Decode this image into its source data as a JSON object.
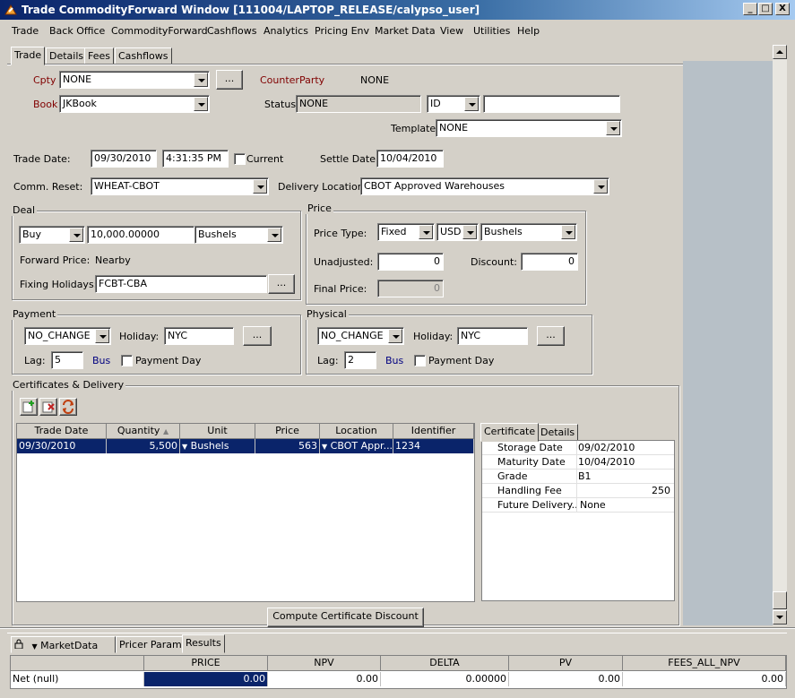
{
  "window": {
    "title": "Trade CommodityForward Window [111004/LAPTOP_RELEASE/calypso_user]",
    "min_glyph": "_",
    "max_glyph": "□",
    "close_glyph": "X"
  },
  "menu": [
    "Trade",
    "Back Office",
    "CommodityForward",
    "Cashflows",
    "Analytics",
    "Pricing Env",
    "Market Data",
    "View",
    "Utilities",
    "Help"
  ],
  "tabs": [
    "Trade",
    "Details",
    "Fees",
    "Cashflows"
  ],
  "trade": {
    "cpty_label": "Cpty",
    "cpty_value": "NONE",
    "ellipsis": "...",
    "counterparty_label": "CounterParty",
    "counterparty_value": "NONE",
    "book_label": "Book",
    "book_value": "JKBook",
    "status_label": "Status",
    "status_value": "NONE",
    "id_value": "ID",
    "id_text": "",
    "template_label": "Template",
    "template_value": "NONE",
    "trade_date_label": "Trade Date:",
    "trade_date": "09/30/2010",
    "trade_time": "4:31:35 PM",
    "current_label": "Current",
    "settle_date_label": "Settle Date:",
    "settle_date": "10/04/2010",
    "comm_reset_label": "Comm. Reset:",
    "comm_reset_value": "WHEAT-CBOT",
    "delivery_location_label": "Delivery Location:",
    "delivery_location_value": "CBOT Approved Warehouses"
  },
  "deal": {
    "title": "Deal",
    "direction": "Buy",
    "quantity": "10,000.00000",
    "unit": "Bushels",
    "forward_price_label": "Forward Price:",
    "forward_price_value": "Nearby",
    "fixing_holidays_label": "Fixing Holidays:",
    "fixing_holidays_value": "FCBT-CBA"
  },
  "price": {
    "title": "Price",
    "price_type_label": "Price Type:",
    "price_type": "Fixed",
    "currency": "USD",
    "unit": "Bushels",
    "unadjusted_label": "Unadjusted:",
    "unadjusted": "0",
    "discount_label": "Discount:",
    "discount": "0",
    "final_price_label": "Final Price:",
    "final_price": "0"
  },
  "payment": {
    "title": "Payment",
    "mode": "NO_CHANGE",
    "holiday_label": "Holiday:",
    "holiday": "NYC",
    "lag_label": "Lag:",
    "lag": "5",
    "bus_label": "Bus",
    "payment_day_label": "Payment Day"
  },
  "physical": {
    "title": "Physical",
    "mode": "NO_CHANGE",
    "holiday_label": "Holiday:",
    "holiday": "NYC",
    "lag_label": "Lag:",
    "lag": "2",
    "bus_label": "Bus",
    "payment_day_label": "Payment Day"
  },
  "certificates": {
    "title": "Certificates & Delivery",
    "columns": [
      "Trade Date",
      "Quantity",
      "Unit",
      "Price",
      "Location",
      "Identifier"
    ],
    "rows": [
      {
        "trade_date": "09/30/2010",
        "quantity": "5,500",
        "unit": "Bushels",
        "price": "563",
        "location": "CBOT Appr...",
        "identifier": "1234"
      }
    ],
    "detail_tabs": [
      "Certificate",
      "Details"
    ],
    "props": [
      {
        "k": "Storage Date",
        "v": "09/02/2010"
      },
      {
        "k": "Maturity Date",
        "v": "10/04/2010"
      },
      {
        "k": "Grade",
        "v": "B1"
      },
      {
        "k": "Handling Fee",
        "v": "250"
      },
      {
        "k": "Future Delivery...",
        "v": "None"
      }
    ],
    "compute_button": "Compute Certificate Discount"
  },
  "bottom": {
    "tabs": [
      "MarketData",
      "Pricer Params",
      "Results"
    ],
    "columns": [
      "",
      "PRICE",
      "NPV",
      "DELTA",
      "PV",
      "FEES_ALL_NPV"
    ],
    "row": [
      "Net (null)",
      "0.00",
      "0.00",
      "0.00000",
      "0.00",
      "0.00"
    ]
  }
}
